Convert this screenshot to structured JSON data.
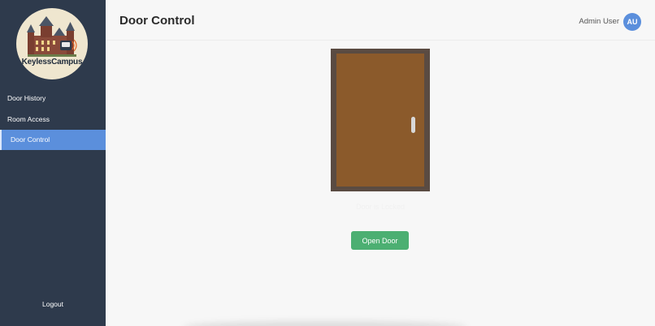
{
  "sidebar": {
    "logo_text": "KeylessCampus",
    "items": [
      {
        "label": "Door History"
      },
      {
        "label": "Room Access"
      },
      {
        "label": "Door Control"
      }
    ],
    "logout_label": "Logout"
  },
  "header": {
    "title": "Door Control",
    "user_name": "Admin User",
    "avatar_initials": "AU"
  },
  "door": {
    "status_text": "Door is Locked",
    "open_button_label": "Open Door"
  },
  "colors": {
    "sidebar_bg": "#2e3a4c",
    "active_item": "#5b8fdc",
    "door": "#8b5a2b",
    "door_frame": "#5a4b42",
    "open_button": "#4caf72"
  },
  "icons": {
    "logo": "castle-keycard-logo",
    "handle": "door-handle"
  }
}
